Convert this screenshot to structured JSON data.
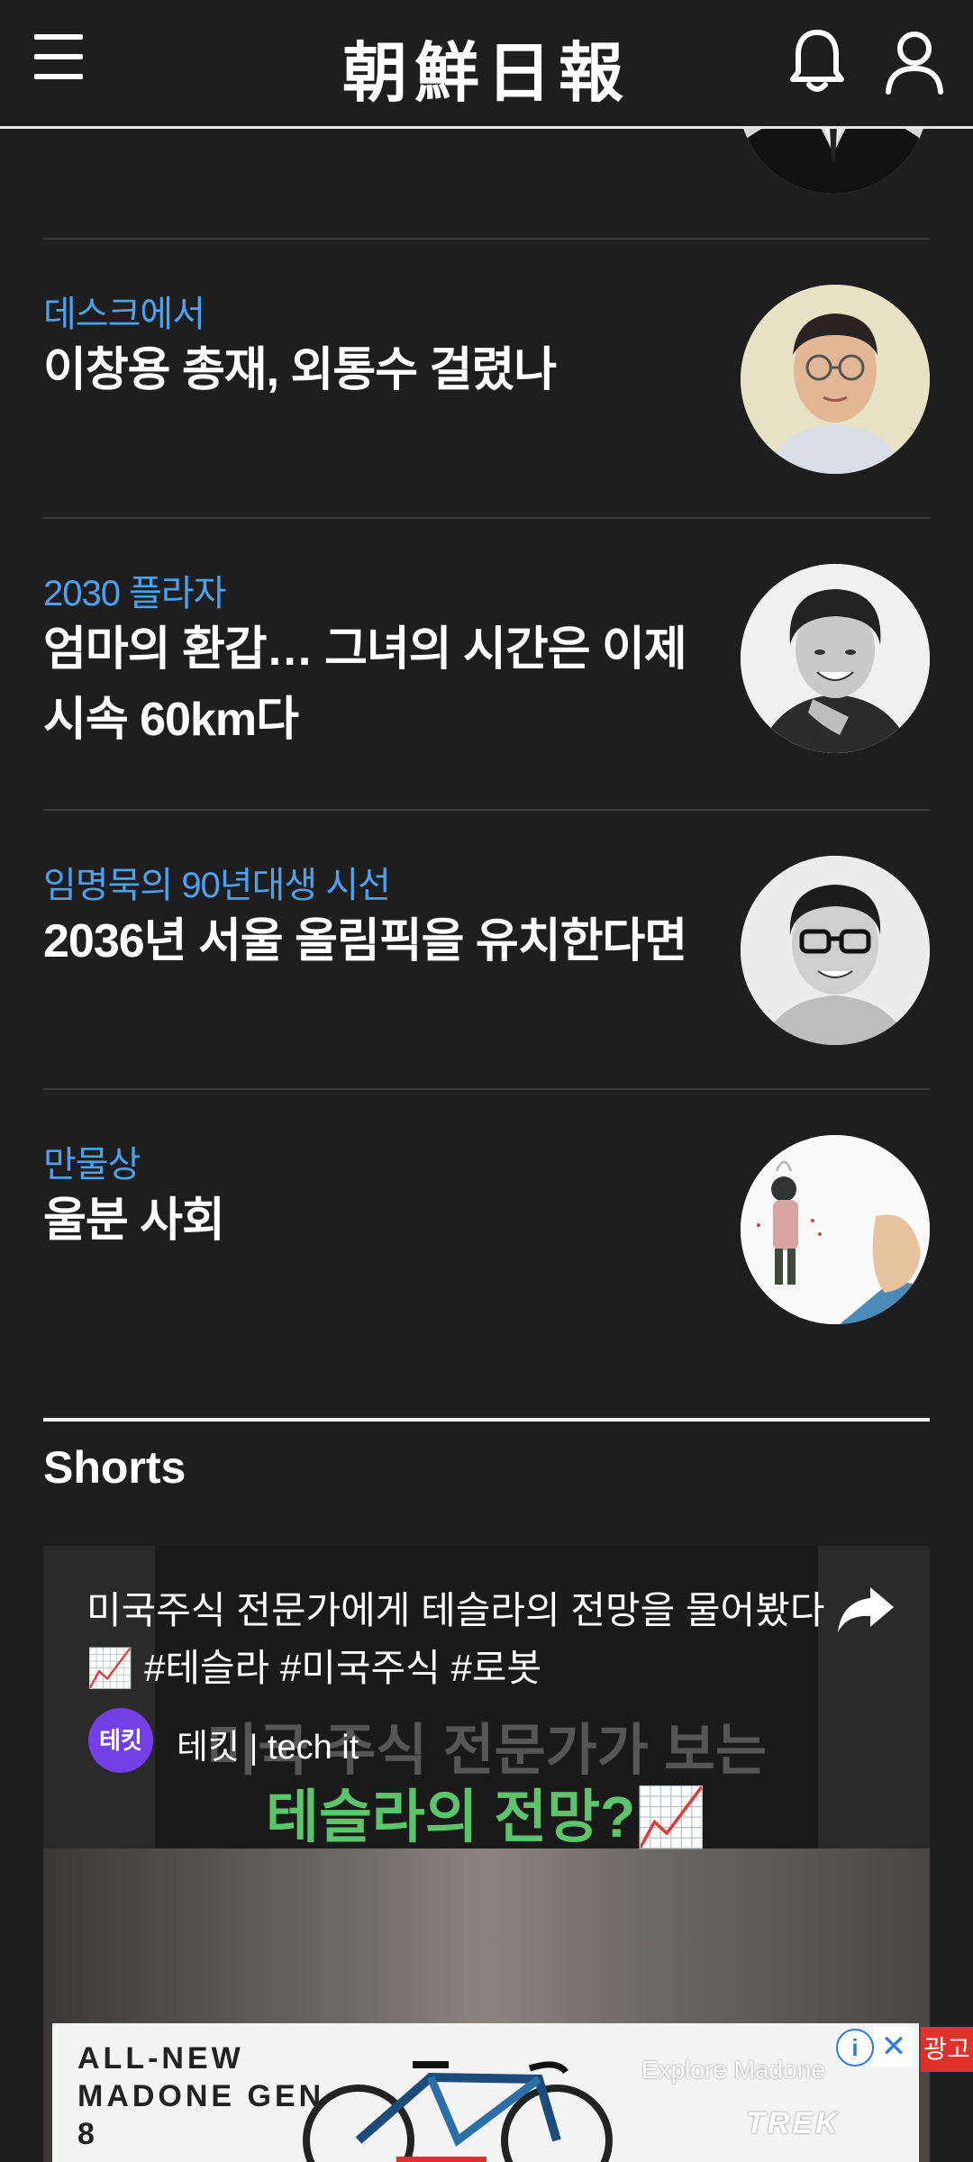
{
  "header": {
    "logo": "朝鮮日報",
    "menu_icon": "hamburger-menu-icon",
    "notification_icon": "bell-icon",
    "account_icon": "user-icon"
  },
  "articles": [
    {
      "kicker": "데스크에서",
      "headline": "이창용 총재, 외통수 걸렸나",
      "avatar": "columnist-photo"
    },
    {
      "kicker": "2030 플라자",
      "headline": "엄마의 환갑… 그녀의 시간은 이제 시속 60km다",
      "avatar": "columnist-photo"
    },
    {
      "kicker": "임명묵의 90년대생 시선",
      "headline": "2036년 서울 올림픽을 유치한다면",
      "avatar": "columnist-photo"
    },
    {
      "kicker": "만물상",
      "headline": "울분 사회",
      "avatar": "illustration"
    }
  ],
  "shorts": {
    "section_title": "Shorts",
    "video": {
      "caption": "미국주식 전문가에게 테슬라의 전망을 물어봤다📈 #테슬라 #미국주식 #로봇",
      "channel_badge": "테킷",
      "channel_name": "테킷 | tech it",
      "thumb_line1": "미국 주식 전문가가 보는",
      "thumb_line2": "테슬라의 전망?📈",
      "share_icon": "share-arrow-icon"
    }
  },
  "ad": {
    "headline": "ALL-NEW MADONE GEN 8",
    "explore": "Explore Madone",
    "brand": "TREK",
    "info": "i",
    "close": "✕",
    "label": "광고"
  },
  "colors": {
    "background": "#1e1e1f",
    "kicker": "#4aa3f0",
    "ad_label": "#e0322b"
  }
}
